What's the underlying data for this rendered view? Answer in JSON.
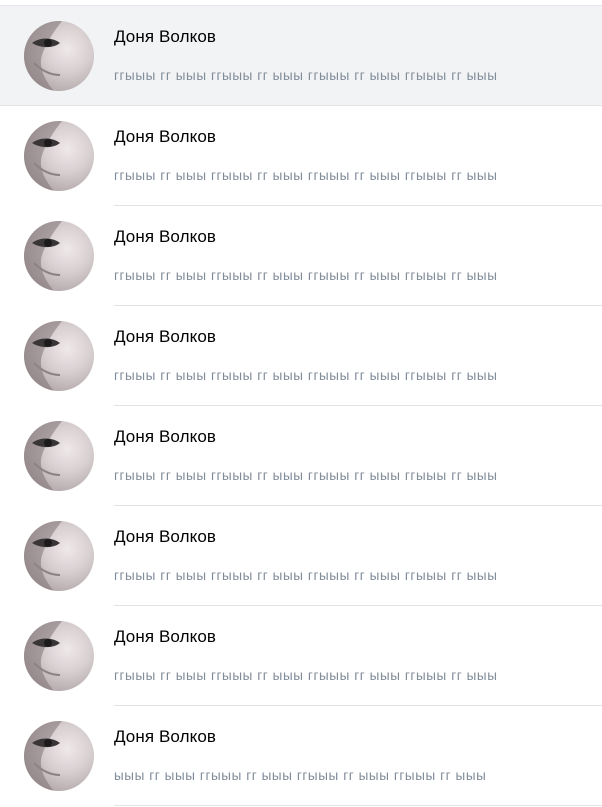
{
  "dialogs": [
    {
      "name": "Доня Волков",
      "preview": "ггыыы гг ыыы ггыыы гг ыыы ггыыы гг ыыы ггыыы гг ыыы",
      "active": true
    },
    {
      "name": "Доня Волков",
      "preview": "ггыыы гг ыыы ггыыы гг ыыы ггыыы гг ыыы ггыыы гг ыыы",
      "active": false
    },
    {
      "name": "Доня Волков",
      "preview": "ггыыы гг ыыы ггыыы гг ыыы ггыыы гг ыыы ггыыы гг ыыы",
      "active": false
    },
    {
      "name": "Доня Волков",
      "preview": "ггыыы гг ыыы ггыыы гг ыыы ггыыы гг ыыы ггыыы гг ыыы",
      "active": false
    },
    {
      "name": "Доня Волков",
      "preview": "ггыыы гг ыыы ггыыы гг ыыы ггыыы гг ыыы ггыыы гг ыыы",
      "active": false
    },
    {
      "name": "Доня Волков",
      "preview": "ггыыы гг ыыы ггыыы гг ыыы ггыыы гг ыыы ггыыы гг ыыы",
      "active": false
    },
    {
      "name": "Доня Волков",
      "preview": "ггыыы гг ыыы ггыыы гг ыыы ггыыы гг ыыы ггыыы гг ыыы",
      "active": false
    },
    {
      "name": "Доня Волков",
      "preview": "ыыы гг ыыы ггыыы гг ыыы ггыыы гг ыыы ггыыы гг ыыы",
      "active": false
    }
  ],
  "colors": {
    "active_row_bg": "#f2f3f5",
    "name": "#000000",
    "preview": "#818c99",
    "separator": "#e1e3e6"
  }
}
